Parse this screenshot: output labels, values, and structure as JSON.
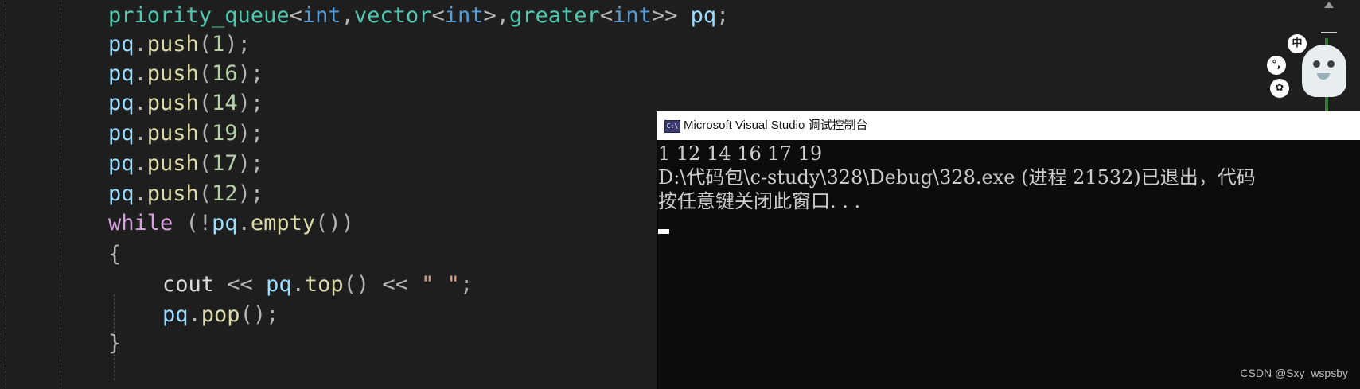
{
  "editor": {
    "lines": [
      {
        "indent": 1,
        "tokens": [
          {
            "text": "priority_queue",
            "cls": "tk-type"
          },
          {
            "text": "<",
            "cls": "tk-pun"
          },
          {
            "text": "int",
            "cls": "tk-kw"
          },
          {
            "text": ",",
            "cls": "tk-pun"
          },
          {
            "text": "vector",
            "cls": "tk-type"
          },
          {
            "text": "<",
            "cls": "tk-pun"
          },
          {
            "text": "int",
            "cls": "tk-kw"
          },
          {
            "text": ">",
            "cls": "tk-pun"
          },
          {
            "text": ",",
            "cls": "tk-pun"
          },
          {
            "text": "greater",
            "cls": "tk-type"
          },
          {
            "text": "<",
            "cls": "tk-pun"
          },
          {
            "text": "int",
            "cls": "tk-kw"
          },
          {
            "text": ">>",
            "cls": "tk-pun"
          },
          {
            "text": " ",
            "cls": "tk-plain"
          },
          {
            "text": "pq",
            "cls": "tk-var"
          },
          {
            "text": ";",
            "cls": "tk-pun"
          }
        ]
      },
      {
        "indent": 1,
        "tokens": [
          {
            "text": "pq",
            "cls": "tk-var"
          },
          {
            "text": ".",
            "cls": "tk-pun"
          },
          {
            "text": "push",
            "cls": "tk-fn"
          },
          {
            "text": "(",
            "cls": "tk-pun"
          },
          {
            "text": "1",
            "cls": "tk-num"
          },
          {
            "text": ");",
            "cls": "tk-pun"
          }
        ]
      },
      {
        "indent": 1,
        "tokens": [
          {
            "text": "pq",
            "cls": "tk-var"
          },
          {
            "text": ".",
            "cls": "tk-pun"
          },
          {
            "text": "push",
            "cls": "tk-fn"
          },
          {
            "text": "(",
            "cls": "tk-pun"
          },
          {
            "text": "16",
            "cls": "tk-num"
          },
          {
            "text": ");",
            "cls": "tk-pun"
          }
        ]
      },
      {
        "indent": 1,
        "tokens": [
          {
            "text": "pq",
            "cls": "tk-var"
          },
          {
            "text": ".",
            "cls": "tk-pun"
          },
          {
            "text": "push",
            "cls": "tk-fn"
          },
          {
            "text": "(",
            "cls": "tk-pun"
          },
          {
            "text": "14",
            "cls": "tk-num"
          },
          {
            "text": ");",
            "cls": "tk-pun"
          }
        ]
      },
      {
        "indent": 1,
        "tokens": [
          {
            "text": "pq",
            "cls": "tk-var"
          },
          {
            "text": ".",
            "cls": "tk-pun"
          },
          {
            "text": "push",
            "cls": "tk-fn"
          },
          {
            "text": "(",
            "cls": "tk-pun"
          },
          {
            "text": "19",
            "cls": "tk-num"
          },
          {
            "text": ");",
            "cls": "tk-pun"
          }
        ]
      },
      {
        "indent": 1,
        "tokens": [
          {
            "text": "pq",
            "cls": "tk-var"
          },
          {
            "text": ".",
            "cls": "tk-pun"
          },
          {
            "text": "push",
            "cls": "tk-fn"
          },
          {
            "text": "(",
            "cls": "tk-pun"
          },
          {
            "text": "17",
            "cls": "tk-num"
          },
          {
            "text": ");",
            "cls": "tk-pun"
          }
        ]
      },
      {
        "indent": 1,
        "tokens": [
          {
            "text": "pq",
            "cls": "tk-var"
          },
          {
            "text": ".",
            "cls": "tk-pun"
          },
          {
            "text": "push",
            "cls": "tk-fn"
          },
          {
            "text": "(",
            "cls": "tk-pun"
          },
          {
            "text": "12",
            "cls": "tk-num"
          },
          {
            "text": ");",
            "cls": "tk-pun"
          }
        ]
      },
      {
        "indent": 1,
        "tokens": [
          {
            "text": "while",
            "cls": "tk-ctrl"
          },
          {
            "text": " (!",
            "cls": "tk-pun"
          },
          {
            "text": "pq",
            "cls": "tk-var"
          },
          {
            "text": ".",
            "cls": "tk-pun"
          },
          {
            "text": "empty",
            "cls": "tk-fn"
          },
          {
            "text": "())",
            "cls": "tk-pun"
          }
        ]
      },
      {
        "indent": 1,
        "tokens": [
          {
            "text": "{",
            "cls": "tk-pun"
          }
        ]
      },
      {
        "indent": 2,
        "tokens": [
          {
            "text": "cout",
            "cls": "tk-plain"
          },
          {
            "text": " << ",
            "cls": "tk-pun"
          },
          {
            "text": "pq",
            "cls": "tk-var"
          },
          {
            "text": ".",
            "cls": "tk-pun"
          },
          {
            "text": "top",
            "cls": "tk-fn"
          },
          {
            "text": "() << ",
            "cls": "tk-pun"
          },
          {
            "text": "\" \"",
            "cls": "tk-str"
          },
          {
            "text": ";",
            "cls": "tk-pun"
          }
        ]
      },
      {
        "indent": 2,
        "tokens": [
          {
            "text": "pq",
            "cls": "tk-var"
          },
          {
            "text": ".",
            "cls": "tk-pun"
          },
          {
            "text": "pop",
            "cls": "tk-fn"
          },
          {
            "text": "();",
            "cls": "tk-pun"
          }
        ]
      },
      {
        "indent": 1,
        "tokens": [
          {
            "text": "}",
            "cls": "tk-pun"
          }
        ]
      }
    ]
  },
  "widget": {
    "btn_lang": "中",
    "btn_punct": "°,",
    "btn_settings": "✿"
  },
  "console": {
    "icon_text": "C:\\",
    "title": "Microsoft Visual Studio 调试控制台",
    "lines": [
      "1 12 14 16 17 19",
      "D:\\代码包\\c-study\\328\\Debug\\328.exe (进程 21532)已退出，代码",
      "按任意键关闭此窗口. . ."
    ]
  },
  "watermark": "CSDN @Sxy_wspsby"
}
